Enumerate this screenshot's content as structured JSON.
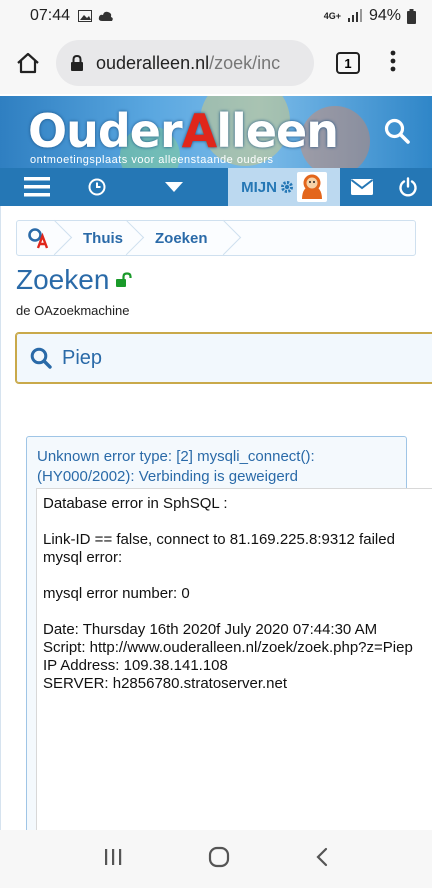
{
  "status_bar": {
    "time": "07:44",
    "network": "4G+",
    "battery": "94%"
  },
  "browser": {
    "url_domain": "ouderalleen.nl",
    "url_path": "/zoek/inc",
    "tab_count": "1"
  },
  "banner": {
    "logo_prefix": "Ouder",
    "logo_a": "A",
    "logo_suffix": "lleen",
    "tagline": "ontmoetingsplaats voor alleenstaande ouders"
  },
  "navbar": {
    "mijn_label": "MIJN"
  },
  "breadcrumb": {
    "items": [
      "Thuis",
      "Zoeken"
    ]
  },
  "page": {
    "title": "Zoeken",
    "subtitle": "de OAzoekmachine"
  },
  "search": {
    "value": "Piep"
  },
  "error": {
    "header": "Unknown error type: [2] mysqli_connect(): (HY000/2002): Verbinding is geweigerd",
    "lines": {
      "l1": "Database error in SphSQL :",
      "l2": "Link-ID == false, connect to 81.169.225.8:9312 failed",
      "l3": "mysql error:",
      "l4": "mysql error number: 0",
      "l5": "Date: Thursday 16th 2020f July 2020 07:44:30 AM",
      "l6": "Script: http://www.ouderalleen.nl/zoek/zoek.php?z=Piep",
      "l7": "IP Address: 109.38.141.108",
      "l8": "SERVER: h2856780.stratoserver.net"
    }
  },
  "colors": {
    "brand_blue": "#2577b5",
    "link_blue": "#2a6aa8",
    "accent_red": "#e0261b",
    "lock_green": "#1a9a2a"
  }
}
